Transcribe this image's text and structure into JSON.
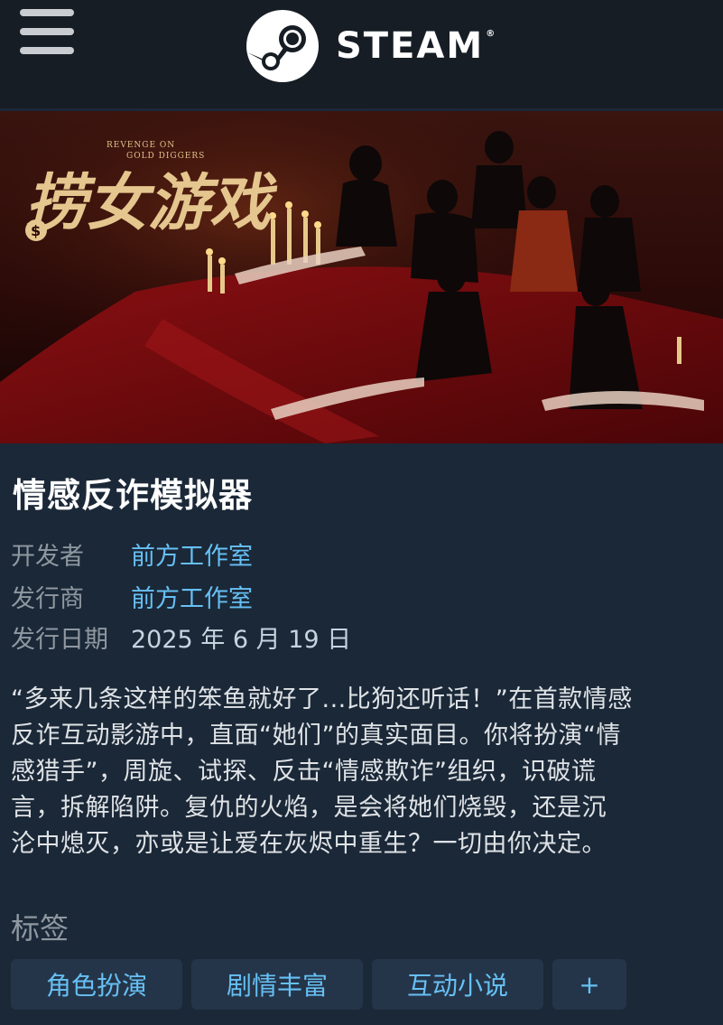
{
  "header": {
    "brand": "STEAM",
    "trademark": "®",
    "menu_icon": "hamburger-menu-icon",
    "logo_icon": "steam-logo-icon"
  },
  "banner": {
    "logo_text": "捞女游戏",
    "logo_subtitle_line1": "REVENGE ON",
    "logo_subtitle_line2": "GOLD DIGGERS",
    "coin_symbol": "$"
  },
  "game": {
    "title": "情感反诈模拟器",
    "developer_label": "开发者",
    "developer": "前方工作室",
    "publisher_label": "发行商",
    "publisher": "前方工作室",
    "release_label": "发行日期",
    "release_date": "2025 年 6 月 19 日",
    "description_lines": [
      "“多来几条这样的笨鱼就好了...比狗还听话！”在首款情感",
      "反诈互动影游中，直面“她们”的真实面目。你将扮演“情",
      "感猎手”，周旋、试探、反击“情感欺诈”组织，识破谎",
      "言，拆解陷阱。复仇的火焰，是会将她们烧毁，还是沉",
      "沦中熄灭，亦或是让爱在灰烬中重生？一切由你决定。"
    ]
  },
  "tags": {
    "label": "标签",
    "items": [
      "角色扮演",
      "剧情丰富",
      "互动小说"
    ],
    "more": "+"
  },
  "colors": {
    "background": "#1b2838",
    "header": "#171d25",
    "link": "#66c0f4",
    "muted": "#8f98a0",
    "tag_bg": "#253549"
  }
}
